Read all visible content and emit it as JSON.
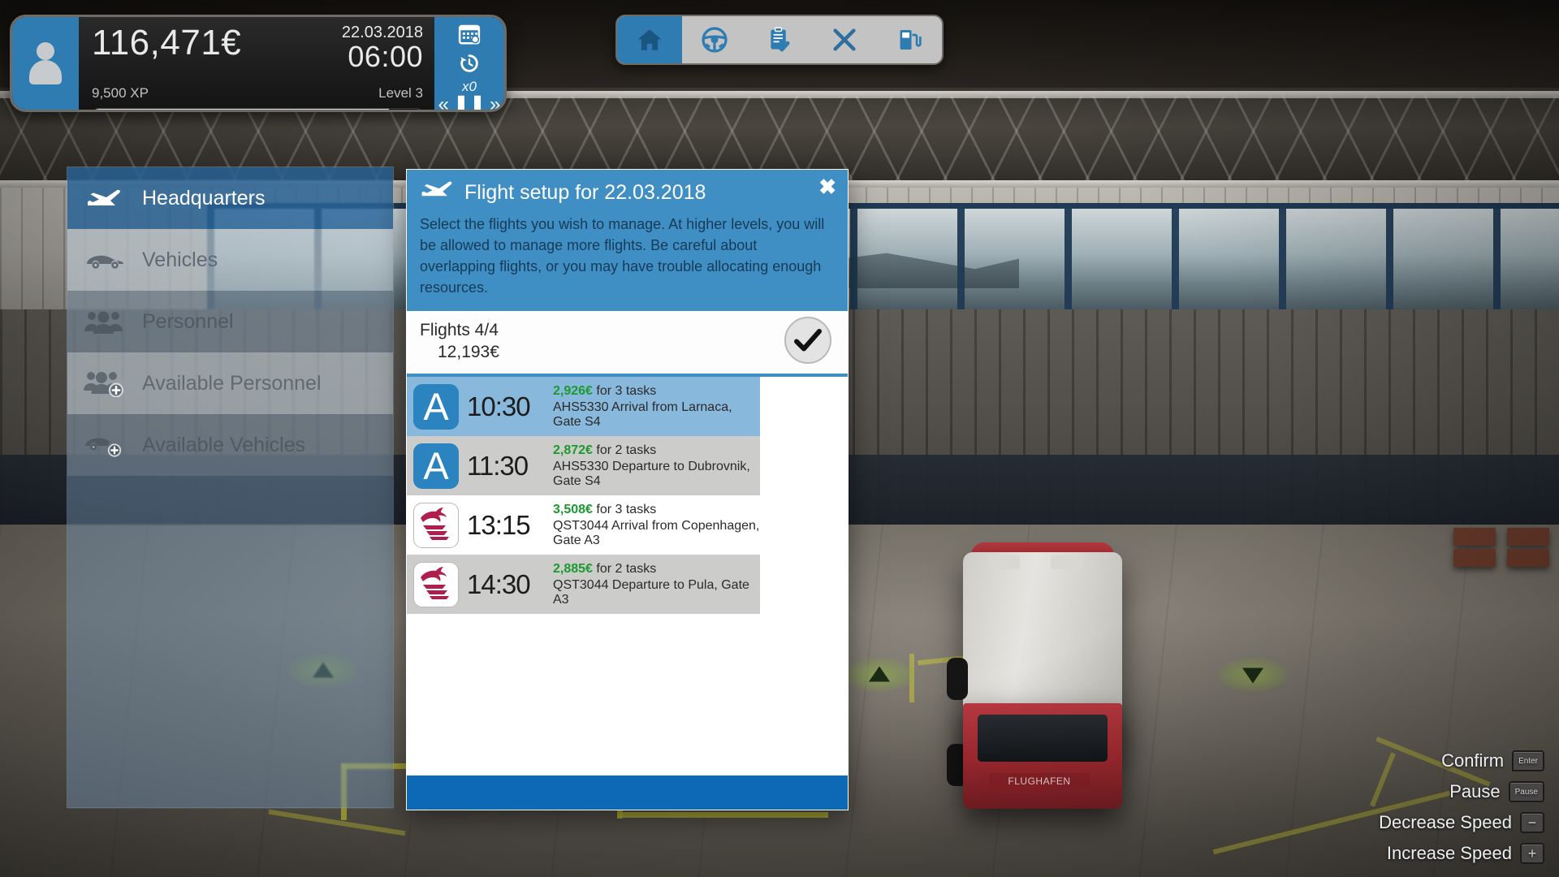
{
  "hud": {
    "money": "116,471€",
    "date": "22.03.2018",
    "time": "06:00",
    "xp": "9,500 XP",
    "level": "Level 3",
    "xp_percent": 90,
    "speed_multiplier": "x0",
    "avatar_icon": "person-icon",
    "calendar_icon": "calendar-icon",
    "history_icon": "clock-history-icon",
    "rewind_glyph": "«",
    "pause_glyph": "❚❚",
    "forward_glyph": "»",
    "accent_color": "#2f7cb2"
  },
  "toolbar": {
    "buttons": [
      {
        "name": "home",
        "icon": "home-icon",
        "active": true
      },
      {
        "name": "vehicles",
        "icon": "steering-wheel-icon",
        "active": false
      },
      {
        "name": "tasks",
        "icon": "clipboard-check-icon",
        "active": false
      },
      {
        "name": "cancel",
        "icon": "cross-icon",
        "active": false
      },
      {
        "name": "fuel",
        "icon": "fuel-pump-icon",
        "active": false
      }
    ]
  },
  "sidebar": {
    "items": [
      {
        "label": "Headquarters",
        "icon": "airplane-icon",
        "state": "selected"
      },
      {
        "label": "Vehicles",
        "icon": "car-icon",
        "state": "light"
      },
      {
        "label": "Personnel",
        "icon": "people-icon",
        "state": "dark"
      },
      {
        "label": "Available Personnel",
        "icon": "people-add-icon",
        "state": "light"
      },
      {
        "label": "Available Vehicles",
        "icon": "car-add-icon",
        "state": "dark"
      }
    ]
  },
  "dialog": {
    "title": "Flight setup for 22.03.2018",
    "title_icon": "airplane-icon",
    "close_label": "✖",
    "description": "Select the flights you wish to manage. At higher levels, you will be allowed to manage more flights.  Be careful about overlapping flights, or you may have trouble allocating enough resources.",
    "summary_count": "Flights 4/4",
    "summary_total": "12,193€",
    "confirm_icon": "checkmark-icon",
    "header_color": "#3f8ec4",
    "footer_color": "#0d68b5",
    "flights": [
      {
        "time": "10:30",
        "price": "2,926€",
        "tasks": "for 3 tasks",
        "description": "AHS5330 Arrival from Larnaca, Gate S4",
        "airline": "AHS",
        "logo": "letter-a-logo",
        "selected": true
      },
      {
        "time": "11:30",
        "price": "2,872€",
        "tasks": "for 2 tasks",
        "description": "AHS5330 Departure to Dubrovnik, Gate S4",
        "airline": "AHS",
        "logo": "letter-a-logo",
        "selected": false
      },
      {
        "time": "13:15",
        "price": "3,508€",
        "tasks": "for 3 tasks",
        "description": "QST3044 Arrival from Copenhagen, Gate A3",
        "airline": "QST",
        "logo": "ibex-head-logo",
        "selected": false
      },
      {
        "time": "14:30",
        "price": "2,885€",
        "tasks": "for 2 tasks",
        "description": "QST3044 Departure to Pula, Gate A3",
        "airline": "QST",
        "logo": "ibex-head-logo",
        "selected": false
      }
    ]
  },
  "hints": [
    {
      "label": "Confirm",
      "key": "Enter"
    },
    {
      "label": "Pause",
      "key": "Pause"
    },
    {
      "label": "Decrease Speed",
      "key": "−"
    },
    {
      "label": "Increase Speed",
      "key": "+"
    }
  ]
}
